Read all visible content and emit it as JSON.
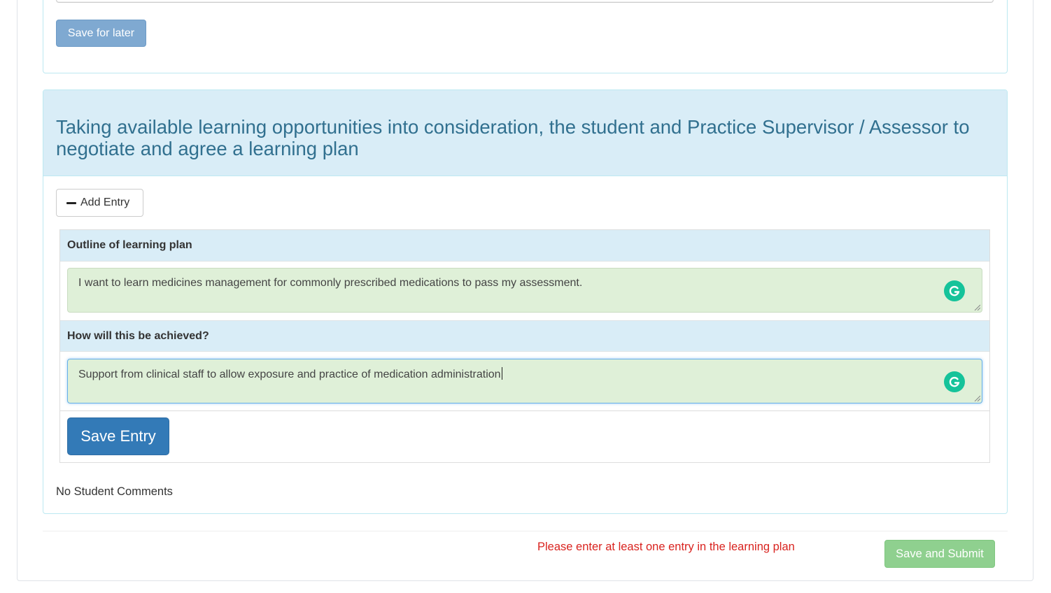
{
  "previous_section": {
    "save_for_later_label": "Save for later"
  },
  "learning_plan": {
    "title": "Taking available learning opportunities into consideration, the student and Practice Supervisor / Assessor to negotiate and agree a learning plan",
    "add_entry_label": "Add Entry",
    "entry": {
      "outline_label": "Outline of learning plan",
      "outline_value": "I want to learn medicines management for commonly prescribed medications to pass my assessment.",
      "how_label": "How will this be achieved?",
      "how_value": "Support from clinical staff to allow exposure and practice of medication administration",
      "save_entry_label": "Save Entry"
    },
    "student_comments": "No Student Comments"
  },
  "footer": {
    "error_message": "Please enter at least one entry in the learning plan",
    "submit_label": "Save and Submit"
  },
  "colors": {
    "panel_heading_bg": "#d9edf7",
    "panel_heading_text": "#31708f",
    "textarea_bg": "#dff0d8",
    "primary_button": "#337ab7",
    "error_text": "#d9231f",
    "success_button": "#8fd08f",
    "grammarly": "#15c39a"
  },
  "icons": {
    "add_entry": "minus-icon",
    "writing_assistant": "grammarly-icon"
  }
}
